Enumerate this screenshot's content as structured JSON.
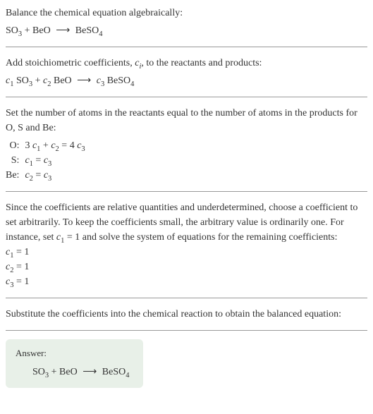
{
  "section1": {
    "line1": "Balance the chemical equation algebraically:",
    "eq_so3": "SO",
    "eq_so3_sub": "3",
    "eq_plus1": " + BeO ",
    "eq_arrow": "⟶",
    "eq_beso4": " BeSO",
    "eq_beso4_sub": "4"
  },
  "section2": {
    "line1_a": "Add stoichiometric coefficients, ",
    "line1_ci": "c",
    "line1_ci_sub": "i",
    "line1_b": ", to the reactants and products:",
    "c1": "c",
    "c1_sub": "1",
    "so3": " SO",
    "so3_sub": "3",
    "plus": " + ",
    "c2": "c",
    "c2_sub": "2",
    "beo": " BeO ",
    "arrow": "⟶",
    "sp": " ",
    "c3": "c",
    "c3_sub": "3",
    "beso4": " BeSO",
    "beso4_sub": "4"
  },
  "section3": {
    "intro": "Set the number of atoms in the reactants equal to the number of atoms in the products for O, S and Be:",
    "rows": [
      {
        "label": "O:",
        "lhs_a": "3 ",
        "lhs_c1": "c",
        "lhs_c1s": "1",
        "lhs_b": " + ",
        "lhs_c2": "c",
        "lhs_c2s": "2",
        "eq": " = ",
        "rhs_a": "4 ",
        "rhs_c3": "c",
        "rhs_c3s": "3"
      },
      {
        "label": "S:",
        "lhs_c1": "c",
        "lhs_c1s": "1",
        "eq": " = ",
        "rhs_c3": "c",
        "rhs_c3s": "3"
      },
      {
        "label": "Be:",
        "lhs_c2": "c",
        "lhs_c2s": "2",
        "eq": " = ",
        "rhs_c3": "c",
        "rhs_c3s": "3"
      }
    ]
  },
  "section4": {
    "intro_a": "Since the coefficients are relative quantities and underdetermined, choose a coefficient to set arbitrarily. To keep the coefficients small, the arbitrary value is ordinarily one. For instance, set ",
    "intro_c1": "c",
    "intro_c1s": "1",
    "intro_b": " = 1 and solve the system of equations for the remaining coefficients:",
    "coefs": [
      {
        "c": "c",
        "s": "1",
        "v": " = 1"
      },
      {
        "c": "c",
        "s": "2",
        "v": " = 1"
      },
      {
        "c": "c",
        "s": "3",
        "v": " = 1"
      }
    ]
  },
  "section5": {
    "intro": "Substitute the coefficients into the chemical reaction to obtain the balanced equation:"
  },
  "answer": {
    "label": "Answer:",
    "so3": "SO",
    "so3_sub": "3",
    "plus_beo": " + BeO ",
    "arrow": "⟶",
    "beso4": " BeSO",
    "beso4_sub": "4"
  }
}
